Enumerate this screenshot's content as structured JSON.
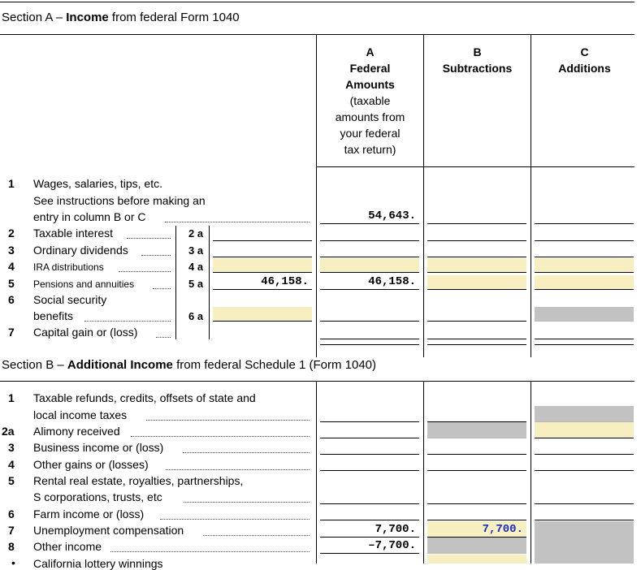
{
  "section_a": {
    "title_prefix": "Section A – ",
    "title_bold": "Income",
    "title_suffix": " from federal Form 1040"
  },
  "columns": {
    "a": {
      "letter": "A",
      "title_line1": "Federal",
      "title_line2": "Amounts",
      "note": [
        "(taxable",
        "amounts from",
        "your federal",
        "tax return)"
      ]
    },
    "b": {
      "letter": "B",
      "title": "Subtractions"
    },
    "c": {
      "letter": "C",
      "title": "Additions"
    }
  },
  "section_a_lines": {
    "l1": {
      "num": "1",
      "text1": "Wages, salaries, tips, etc.",
      "text2": "See instructions before making an",
      "text3": "entry in column B or C",
      "colA": "54,643."
    },
    "l2": {
      "num": "2",
      "text": "Taxable interest",
      "sub": "2 a"
    },
    "l3": {
      "num": "3",
      "text": "Ordinary dividends",
      "sub": "3 a"
    },
    "l4": {
      "num": "4",
      "text": "IRA distributions",
      "sub": "4 a"
    },
    "l5": {
      "num": "5",
      "text": "Pensions and annuities",
      "sub": "5 a",
      "subval": "46,158.",
      "colA": "46,158."
    },
    "l6": {
      "num": "6",
      "text1": "Social security",
      "text2": "benefits",
      "sub": "6 a"
    },
    "l7": {
      "num": "7",
      "text": "Capital gain or (loss)"
    }
  },
  "section_b": {
    "title_prefix": "Section B – ",
    "title_bold": "Additional Income",
    "title_suffix": " from federal Schedule 1 (Form 1040)"
  },
  "section_b_lines": {
    "l1": {
      "num": "1",
      "text1": "Taxable refunds, credits, offsets of state and",
      "text2": "local income taxes"
    },
    "l2a": {
      "num": "2a",
      "text": "Alimony received"
    },
    "l3": {
      "num": "3",
      "text": "Business income or (loss)"
    },
    "l4": {
      "num": "4",
      "text": "Other gains or (losses)"
    },
    "l5": {
      "num": "5",
      "text1": "Rental real estate, royalties, partnerships,",
      "text2": "S corporations, trusts, etc"
    },
    "l6": {
      "num": "6",
      "text": "Farm income or (loss)"
    },
    "l7": {
      "num": "7",
      "text": "Unemployment compensation",
      "colA": "7,700.",
      "colB": "7,700."
    },
    "l8": {
      "num": "8",
      "text": "Other income",
      "colA": "–7,700."
    },
    "l8a": {
      "bullet": "•",
      "text": "California lottery winnings"
    }
  },
  "colors": {
    "yellow": "#f7efc0",
    "gray": "#c2c2c2",
    "blue_value": "#1a2cc7"
  }
}
